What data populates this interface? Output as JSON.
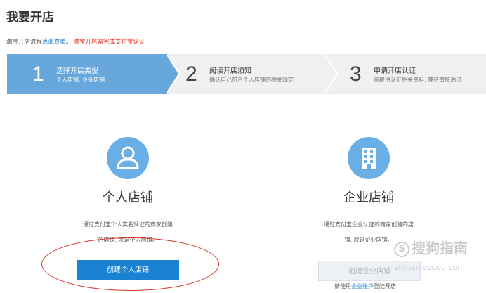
{
  "page": {
    "title": "我要开店"
  },
  "notice": {
    "prefix": "淘宝开店流程",
    "link": "点此查看",
    "suffix": "。",
    "warning": "淘宝开店需完成支付宝认证"
  },
  "steps": [
    {
      "number": "1",
      "title": "选择开店类型",
      "desc": "个人店铺, 企业店铺"
    },
    {
      "number": "2",
      "title": "阅读开店须知",
      "desc": "确认自己符合个人店铺的相关规定"
    },
    {
      "number": "3",
      "title": "申请开店认证",
      "desc": "需提供认证相关资料, 等待审核通过"
    }
  ],
  "personal": {
    "icon": "user-icon",
    "title": "个人店铺",
    "desc_line1": "通过支付宝个人实名认证的商家创建",
    "desc_line2": "的店铺, 就是个人店铺。",
    "button": "创建个人店铺"
  },
  "business": {
    "icon": "building-icon",
    "title": "企业店铺",
    "desc_line1": "通过支付宝企业认证的商家创建的店",
    "desc_line2": "铺, 就是企业店铺。",
    "button": "创建企业店铺",
    "hint_prefix": "请使用",
    "hint_link": "企业账户",
    "hint_suffix": "登陆开店"
  },
  "watermark": {
    "brand": "搜狗指南",
    "logo": "S",
    "url": "zhinan.sogou.com"
  },
  "colors": {
    "active_step": "#68a7dc",
    "inactive_step": "#f0f0f0",
    "primary_button": "#1a82d2",
    "icon_circle": "#6aaee6",
    "warning": "#e0301e",
    "link": "#1a7fcf",
    "highlight": "#d9332a"
  }
}
